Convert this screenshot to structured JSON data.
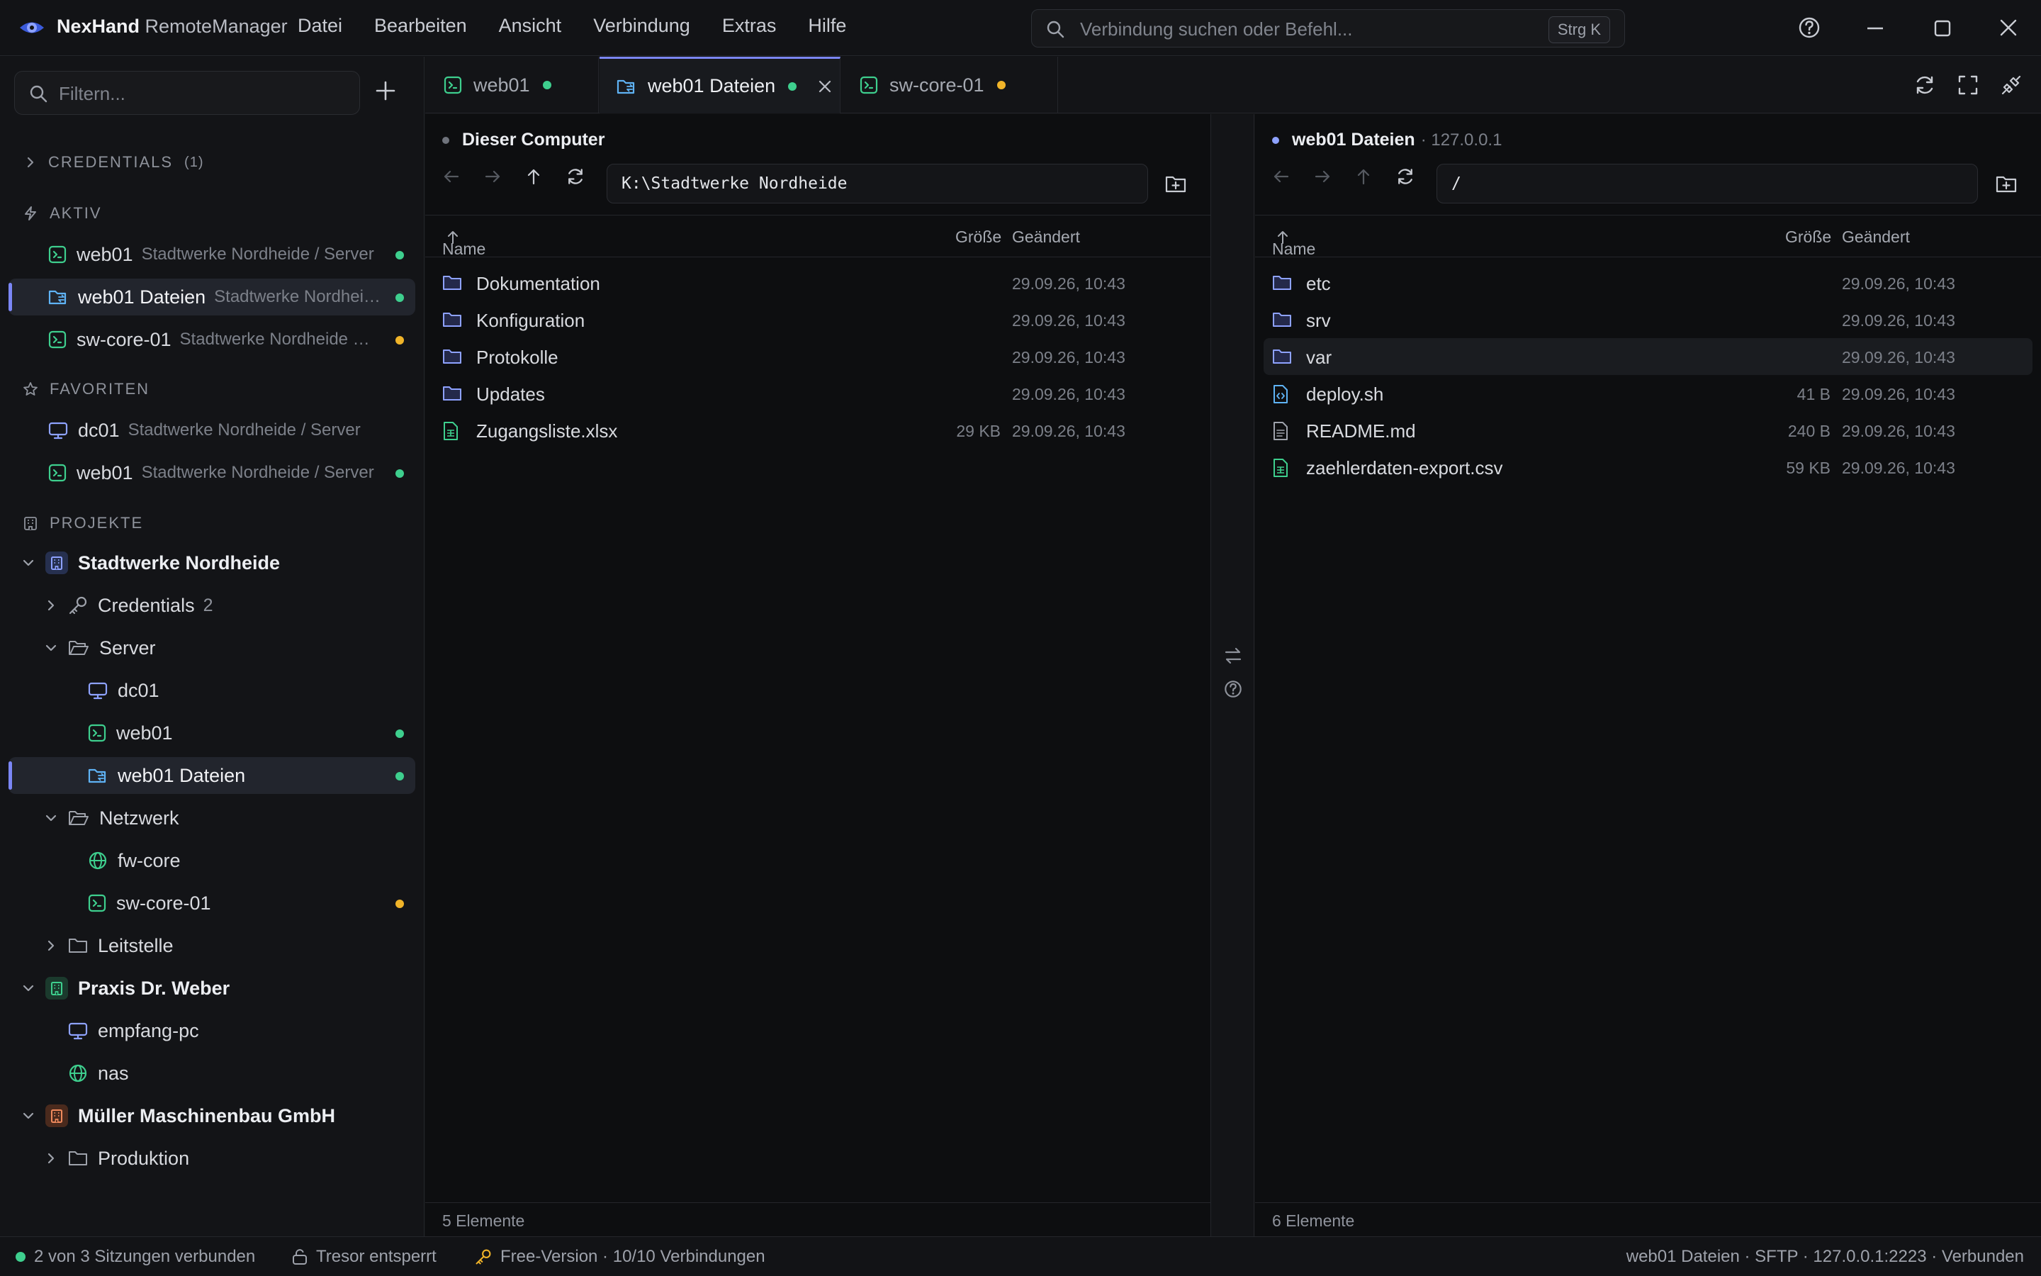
{
  "app": {
    "brand_bold": "NexHand",
    "brand_rest": " RemoteManager",
    "menu": [
      "Datei",
      "Bearbeiten",
      "Ansicht",
      "Verbindung",
      "Extras",
      "Hilfe"
    ],
    "command_placeholder": "Verbindung suchen oder Befehl...",
    "command_shortcut": "Strg K",
    "accent": "#7b86f5"
  },
  "sidebar": {
    "filter_placeholder": "Filtern...",
    "credentials_section": "CREDENTIALS",
    "credentials_count": "(1)",
    "active_section": "AKTIV",
    "active": [
      {
        "name": "web01",
        "sub": "Stadtwerke Nordheide / Server",
        "icon": "terminal-icon",
        "status": "green"
      },
      {
        "name": "web01 Dateien",
        "sub": "Stadtwerke Nordhei…",
        "icon": "sftp-icon",
        "status": "green",
        "selected": true
      },
      {
        "name": "sw-core-01",
        "sub": "Stadtwerke Nordheide …",
        "icon": "terminal-icon",
        "status": "amber"
      }
    ],
    "favorites_section": "FAVORITEN",
    "favorites": [
      {
        "name": "dc01",
        "sub": "Stadtwerke Nordheide / Server",
        "icon": "monitor-icon"
      },
      {
        "name": "web01",
        "sub": "Stadtwerke Nordheide / Server",
        "icon": "terminal-icon",
        "status": "green"
      }
    ],
    "projects_section": "PROJEKTE",
    "tree": {
      "p1": "Stadtwerke Nordheide",
      "p1_credentials": "Credentials",
      "p1_credentials_count": "2",
      "p1_server": "Server",
      "p1_server_items": [
        "dc01",
        "web01",
        "web01 Dateien"
      ],
      "p1_netzwerk": "Netzwerk",
      "p1_netzwerk_items": [
        "fw-core",
        "sw-core-01"
      ],
      "p1_leitstelle": "Leitstelle",
      "p2": "Praxis Dr. Weber",
      "p2_items": [
        "empfang-pc",
        "nas"
      ],
      "p3": "Müller Maschinenbau GmbH",
      "p3_produktion": "Produktion"
    }
  },
  "tabs": [
    {
      "label": "web01",
      "status": "green"
    },
    {
      "label": "web01 Dateien",
      "status": "green",
      "active": true
    },
    {
      "label": "sw-core-01",
      "status": "amber"
    }
  ],
  "local": {
    "title": "Dieser Computer",
    "path": "K:\\Stadtwerke Nordheide",
    "col_name": "Name",
    "col_size": "Größe",
    "col_date": "Geändert",
    "files": [
      {
        "name": "Dokumentation",
        "type": "folder",
        "size": "",
        "date": "29.09.26, 10:43"
      },
      {
        "name": "Konfiguration",
        "type": "folder",
        "size": "",
        "date": "29.09.26, 10:43"
      },
      {
        "name": "Protokolle",
        "type": "folder",
        "size": "",
        "date": "29.09.26, 10:43"
      },
      {
        "name": "Updates",
        "type": "folder",
        "size": "",
        "date": "29.09.26, 10:43"
      },
      {
        "name": "Zugangsliste.xlsx",
        "type": "sheet",
        "size": "29 KB",
        "date": "29.09.26, 10:43"
      }
    ],
    "footer": "5 Elemente"
  },
  "remote": {
    "title": "web01 Dateien",
    "sub": "· 127.0.0.1",
    "path": "/",
    "col_name": "Name",
    "col_size": "Größe",
    "col_date": "Geändert",
    "files": [
      {
        "name": "etc",
        "type": "folder",
        "size": "",
        "date": "29.09.26, 10:43"
      },
      {
        "name": "srv",
        "type": "folder",
        "size": "",
        "date": "29.09.26, 10:43"
      },
      {
        "name": "var",
        "type": "folder",
        "size": "",
        "date": "29.09.26, 10:43"
      },
      {
        "name": "deploy.sh",
        "type": "code",
        "size": "41 B",
        "date": "29.09.26, 10:43"
      },
      {
        "name": "README.md",
        "type": "doc",
        "size": "240 B",
        "date": "29.09.26, 10:43"
      },
      {
        "name": "zaehlerdaten-export.csv",
        "type": "sheet",
        "size": "59 KB",
        "date": "29.09.26, 10:43"
      }
    ],
    "footer": "6 Elemente"
  },
  "status": {
    "sessions": "2 von 3 Sitzungen verbunden",
    "vault": "Tresor entsperrt",
    "license": "Free-Version · 10/10 Verbindungen",
    "connection": "web01 Dateien · SFTP · 127.0.0.1:2223 · Verbunden"
  }
}
